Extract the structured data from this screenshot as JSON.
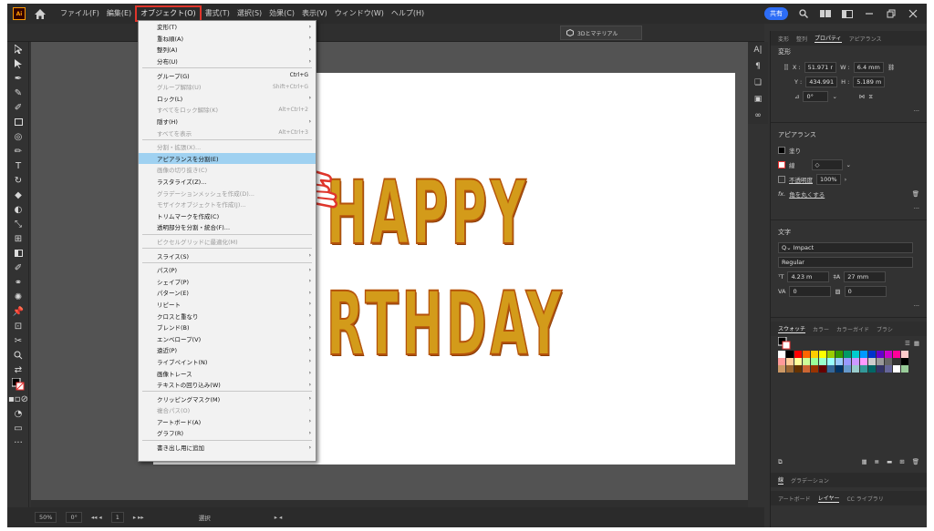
{
  "app": {
    "logo": "Ai",
    "home_icon": "home-icon"
  },
  "menubar": {
    "items": [
      "ファイル(F)",
      "編集(E)",
      "オブジェクト(O)",
      "書式(T)",
      "選択(S)",
      "効果(C)",
      "表示(V)",
      "ウィンドウ(W)",
      "ヘルプ(H)"
    ],
    "active_index": 2,
    "share_label": "共有"
  },
  "ctrlbar": {
    "threed_label": "3Dとマテリアル"
  },
  "object_menu": {
    "items": [
      {
        "label": "変形(T)",
        "arrow": true
      },
      {
        "label": "重ね順(A)",
        "arrow": true
      },
      {
        "label": "整列(A)",
        "arrow": true
      },
      {
        "label": "分布(U)",
        "arrow": true
      },
      {
        "sep": true
      },
      {
        "label": "グループ(G)",
        "shortcut": "Ctrl+G"
      },
      {
        "label": "グループ解除(U)",
        "shortcut": "Shift+Ctrl+G",
        "disabled": true
      },
      {
        "label": "ロック(L)",
        "arrow": true
      },
      {
        "label": "すべてをロック解除(K)",
        "shortcut": "Alt+Ctrl+2",
        "disabled": true
      },
      {
        "label": "隠す(H)",
        "arrow": true
      },
      {
        "label": "すべてを表示",
        "shortcut": "Alt+Ctrl+3",
        "disabled": true
      },
      {
        "sep": true
      },
      {
        "label": "分割・拡張(X)...",
        "disabled": true
      },
      {
        "label": "アピアランスを分割(E)",
        "highlight": true
      },
      {
        "label": "画像の切り抜き(C)",
        "disabled": true
      },
      {
        "label": "ラスタライズ(Z)..."
      },
      {
        "label": "グラデーションメッシュを作成(D)...",
        "disabled": true
      },
      {
        "label": "モザイクオブジェクトを作成(J)...",
        "disabled": true
      },
      {
        "label": "トリムマークを作成(C)"
      },
      {
        "label": "透明部分を分割・統合(F)..."
      },
      {
        "sep": true
      },
      {
        "label": "ピクセルグリッドに最適化(M)",
        "disabled": true
      },
      {
        "sep": true
      },
      {
        "label": "スライス(S)",
        "arrow": true
      },
      {
        "sep": true
      },
      {
        "label": "パス(P)",
        "arrow": true
      },
      {
        "label": "シェイプ(P)",
        "arrow": true
      },
      {
        "label": "パターン(E)",
        "arrow": true
      },
      {
        "label": "リピート",
        "arrow": true
      },
      {
        "label": "クロスと重なり",
        "arrow": true
      },
      {
        "label": "ブレンド(B)",
        "arrow": true
      },
      {
        "label": "エンベロープ(V)",
        "arrow": true
      },
      {
        "label": "遠近(P)",
        "arrow": true
      },
      {
        "label": "ライブペイント(N)",
        "arrow": true
      },
      {
        "label": "画像トレース",
        "arrow": true
      },
      {
        "label": "テキストの回り込み(W)",
        "arrow": true
      },
      {
        "sep": true
      },
      {
        "label": "クリッピングマスク(M)",
        "arrow": true
      },
      {
        "label": "複合パス(O)",
        "arrow": true,
        "disabled": true
      },
      {
        "label": "アートボード(A)",
        "arrow": true
      },
      {
        "label": "グラフ(R)",
        "arrow": true
      },
      {
        "sep": true
      },
      {
        "label": "書き出し用に追加",
        "arrow": true
      }
    ]
  },
  "artwork": {
    "line1": "HAPPY",
    "line2": "RTHDAY"
  },
  "panel": {
    "tabs": [
      "変形",
      "整列",
      "プロパティ",
      "アピアランス"
    ],
    "active_tab": 2,
    "transform_title": "変形",
    "x_label": "X :",
    "x_value": "51.971 r",
    "w_label": "W :",
    "w_value": "6.4 mm",
    "y_label": "Y :",
    "y_value": "434.991",
    "h_label": "H :",
    "h_value": "5.189 m",
    "angle_value": "0°",
    "appearance_title": "アピアランス",
    "fill_label": "塗り",
    "stroke_label": "線",
    "opacity_label": "不透明度",
    "opacity_value": "100%",
    "fx_label": "角を丸くする",
    "character_title": "文字",
    "font_name": "Impact",
    "font_style": "Regular",
    "font_size": "4.23 m",
    "leading": "27 mm",
    "tracking": "0",
    "kerning": "0",
    "swatch_tabs": [
      "スウォッチ",
      "カラー",
      "カラーガイド",
      "ブラシ"
    ],
    "gradient_tabs": [
      "線",
      "グラデーション"
    ],
    "layer_tabs": [
      "アートボード",
      "レイヤー",
      "CC ライブラリ"
    ],
    "swatch_colors": [
      "#ffffff",
      "#000000",
      "#ff0000",
      "#ff6600",
      "#ffcc00",
      "#ffff00",
      "#99cc00",
      "#339900",
      "#009966",
      "#00cccc",
      "#0099ff",
      "#0033cc",
      "#6600cc",
      "#cc00cc",
      "#ff0099",
      "#ffcccc",
      "#ff9999",
      "#ffcc99",
      "#ffff99",
      "#ccff99",
      "#99ff99",
      "#99ffcc",
      "#99ffff",
      "#99ccff",
      "#9999ff",
      "#cc99ff",
      "#ff99ff",
      "#cccccc",
      "#999999",
      "#666666",
      "#333333",
      "#000000",
      "#cc9966",
      "#996633",
      "#663300",
      "#cc6633",
      "#993300",
      "#660000",
      "#336699",
      "#003366",
      "#6699cc",
      "#99cccc",
      "#339999",
      "#006666",
      "#333366",
      "#666699",
      "#ffffff",
      "#99cc99"
    ]
  },
  "statusbar": {
    "zoom": "50%",
    "rotate": "0°",
    "artboard": "1",
    "mode": "選択"
  }
}
